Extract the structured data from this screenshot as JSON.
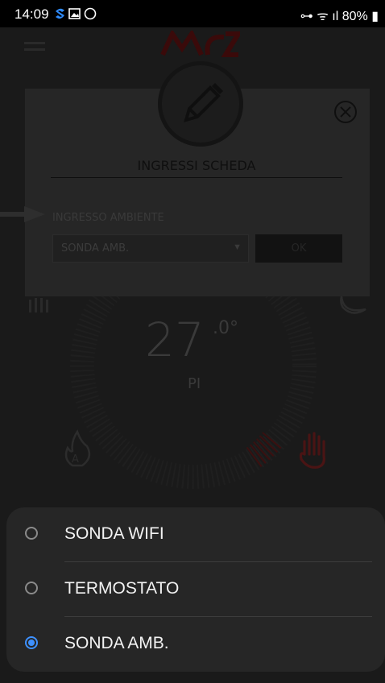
{
  "status_bar": {
    "time": "14:09",
    "battery": "80%"
  },
  "dialog": {
    "title": "INGRESSI SCHEDA",
    "field_label": "INGRESSO AMBIENTE",
    "select_value": "SONDA AMB.",
    "ok_label": "OK"
  },
  "background": {
    "temperature": "27",
    "temperature_decimal": ".0°",
    "mode": "PI"
  },
  "sheet": {
    "options": [
      {
        "label": "SONDA WIFI",
        "selected": false
      },
      {
        "label": "TERMOSTATO",
        "selected": false
      },
      {
        "label": "SONDA AMB.",
        "selected": true
      }
    ]
  },
  "colors": {
    "accent": "#3e91ff",
    "sheet_bg": "#262626"
  }
}
